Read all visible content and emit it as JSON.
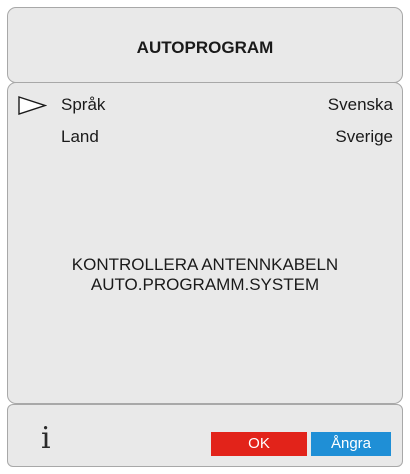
{
  "header": {
    "title": "AUTOPROGRAM"
  },
  "settings": [
    {
      "label": "Språk",
      "value": "Svenska",
      "selected": true
    },
    {
      "label": "Land",
      "value": "Sverige",
      "selected": false
    }
  ],
  "messages": {
    "line1": "KONTROLLERA ANTENNKABELN",
    "line2": "AUTO.PROGRAMM.SYSTEM"
  },
  "footer": {
    "info_icon": "i",
    "ok_label": "OK",
    "back_label": "Ångra"
  },
  "colors": {
    "ok": "#e2231a",
    "back": "#1f8fd6",
    "panel": "#e9e9e9"
  }
}
